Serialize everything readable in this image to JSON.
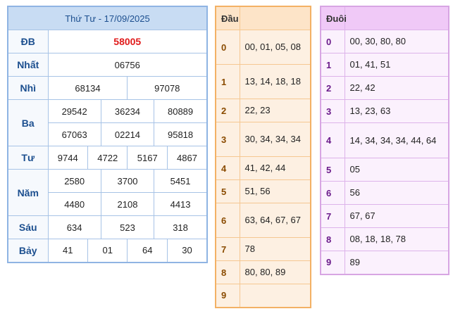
{
  "results": {
    "title": "Thứ Tư - 17/09/2025",
    "prizes": {
      "db": {
        "label": "ĐB",
        "values": [
          "58005"
        ]
      },
      "nhat": {
        "label": "Nhất",
        "values": [
          "06756"
        ]
      },
      "nhi": {
        "label": "Nhì",
        "values": [
          "68134",
          "97078"
        ]
      },
      "ba": {
        "label": "Ba",
        "values": [
          "29542",
          "36234",
          "80889",
          "67063",
          "02214",
          "95818"
        ]
      },
      "tu": {
        "label": "Tư",
        "values": [
          "9744",
          "4722",
          "5167",
          "4867"
        ]
      },
      "nam": {
        "label": "Năm",
        "values": [
          "2580",
          "3700",
          "5451",
          "4480",
          "2108",
          "4413"
        ]
      },
      "sau": {
        "label": "Sáu",
        "values": [
          "634",
          "523",
          "318"
        ]
      },
      "bay": {
        "label": "Bảy",
        "values": [
          "41",
          "01",
          "64",
          "30"
        ]
      }
    }
  },
  "dau": {
    "header": "Đầu",
    "rows": [
      {
        "key": "0",
        "value": "00, 01, 05, 08"
      },
      {
        "key": "1",
        "value": "13, 14, 18, 18"
      },
      {
        "key": "2",
        "value": "22, 23"
      },
      {
        "key": "3",
        "value": "30, 34, 34, 34"
      },
      {
        "key": "4",
        "value": "41, 42, 44"
      },
      {
        "key": "5",
        "value": "51, 56"
      },
      {
        "key": "6",
        "value": "63, 64, 67, 67"
      },
      {
        "key": "7",
        "value": "78"
      },
      {
        "key": "8",
        "value": "80, 80, 89"
      },
      {
        "key": "9",
        "value": ""
      }
    ]
  },
  "duoi": {
    "header": "Đuôi",
    "rows": [
      {
        "key": "0",
        "value": "00, 30, 80, 80"
      },
      {
        "key": "1",
        "value": "01, 41, 51"
      },
      {
        "key": "2",
        "value": "22, 42"
      },
      {
        "key": "3",
        "value": "13, 23, 63"
      },
      {
        "key": "4",
        "value": "14, 34, 34, 34, 44, 64"
      },
      {
        "key": "5",
        "value": "05"
      },
      {
        "key": "6",
        "value": "56"
      },
      {
        "key": "7",
        "value": "67, 67"
      },
      {
        "key": "8",
        "value": "08, 18, 18, 78"
      },
      {
        "key": "9",
        "value": "89"
      }
    ]
  },
  "colors": {
    "title_bg": "#c8dcf3",
    "special_prize": "#e01b1b",
    "dau_bg": "#fdf0e2",
    "duoi_bg": "#fbf1fd"
  }
}
